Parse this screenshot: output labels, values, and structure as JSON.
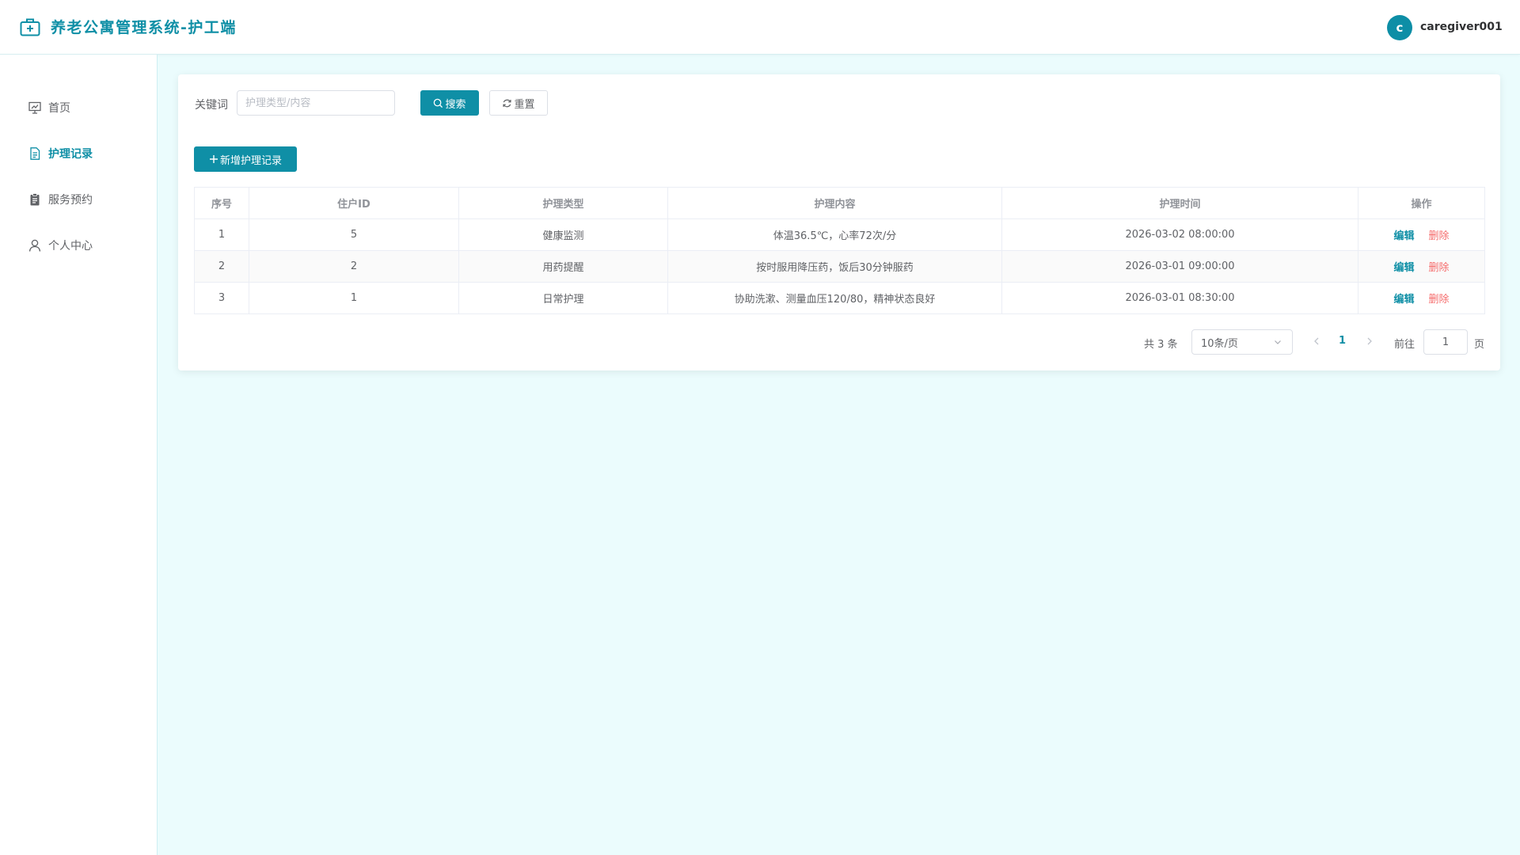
{
  "header": {
    "title": "养老公寓管理系统-护工端",
    "avatar_letter": "c",
    "username": "caregiver001"
  },
  "colors": {
    "accent": "#0f8fa6",
    "danger": "#f56c6c",
    "background": "#ebfcfd"
  },
  "sidebar": {
    "items": [
      {
        "label": "首页",
        "icon": "presentation-icon"
      },
      {
        "label": "护理记录",
        "icon": "document-icon",
        "active": true
      },
      {
        "label": "服务预约",
        "icon": "clipboard-icon"
      },
      {
        "label": "个人中心",
        "icon": "user-icon"
      }
    ]
  },
  "search": {
    "label": "关键词",
    "placeholder": "护理类型/内容",
    "value": "",
    "search_button": "搜索",
    "reset_button": "重置"
  },
  "toolbar": {
    "add_button": "新增护理记录"
  },
  "table": {
    "headers": [
      "序号",
      "住户ID",
      "护理类型",
      "护理内容",
      "护理时间",
      "操作"
    ],
    "rows": [
      {
        "index": "1",
        "resident_id": "5",
        "type": "健康监测",
        "content": "体温36.5℃，心率72次/分",
        "time": "2026-03-02 08:00:00"
      },
      {
        "index": "2",
        "resident_id": "2",
        "type": "用药提醒",
        "content": "按时服用降压药，饭后30分钟服药",
        "time": "2026-03-01 09:00:00"
      },
      {
        "index": "3",
        "resident_id": "1",
        "type": "日常护理",
        "content": "协助洗漱、测量血压120/80，精神状态良好",
        "time": "2026-03-01 08:30:00"
      }
    ],
    "edit_label": "编辑",
    "delete_label": "删除"
  },
  "pagination": {
    "total_text": "共 3 条",
    "page_size": "10条/页",
    "current_page": "1",
    "goto_label": "前往",
    "goto_value": "1",
    "page_suffix": "页"
  }
}
